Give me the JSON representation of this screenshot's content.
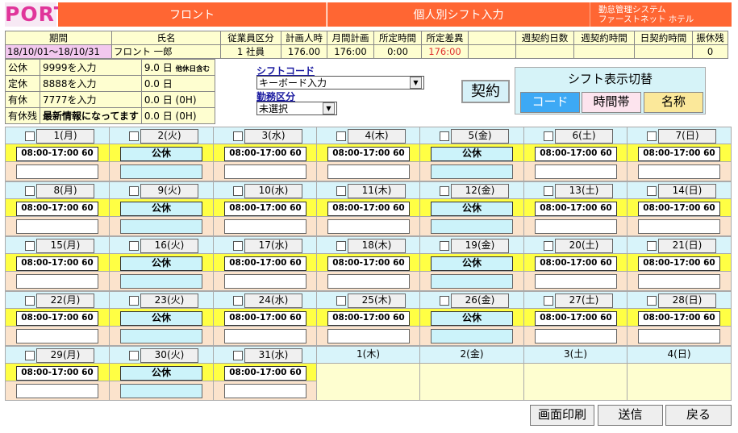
{
  "header": {
    "logo": "PORT",
    "section": "フロント",
    "screen_title": "個人別シフト入力",
    "system_line1": "勤怠管理システム",
    "system_line2": "ファーストネット ホテル"
  },
  "info": {
    "headers": [
      "期間",
      "氏名",
      "従業員区分",
      "計画人時",
      "月間計画",
      "所定時間",
      "所定差異",
      "",
      "週契約日数",
      "週契約時間",
      "日契約時間",
      "振休残"
    ],
    "values": [
      "18/10/01〜18/10/31",
      "フロント 一郎",
      "1 社員",
      "176.00",
      "176:00",
      "0:00",
      "176:00",
      "",
      "",
      "",
      "",
      "0"
    ]
  },
  "summary": [
    {
      "label": "公休",
      "code": "9999を入力",
      "value": "9.0 日",
      "note": "他休日含む"
    },
    {
      "label": "定休",
      "code": "8888を入力",
      "value": "0.0 日",
      "note": ""
    },
    {
      "label": "有休",
      "code": "7777を入力",
      "value": "0.0 日 (0H)",
      "note": ""
    },
    {
      "label": "有休残",
      "code": "最新情報になってます",
      "value": "0.0 日 (0H)",
      "note": ""
    }
  ],
  "controls": {
    "shift_code_label": "シフトコード",
    "shift_code_value": "キーボード入力",
    "work_type_label": "勤務区分",
    "work_type_value": "未選択",
    "contract_button": "契約",
    "display_toggle_title": "シフト表示切替",
    "toggle_code": "コード",
    "toggle_time": "時間帯",
    "toggle_name": "名称"
  },
  "calendar": {
    "days": [
      {
        "label": "1(月)",
        "shift": "08:00-17:00 60",
        "kind": "work"
      },
      {
        "label": "2(火)",
        "shift": "公休",
        "kind": "off"
      },
      {
        "label": "3(水)",
        "shift": "08:00-17:00 60",
        "kind": "work"
      },
      {
        "label": "4(木)",
        "shift": "08:00-17:00 60",
        "kind": "work"
      },
      {
        "label": "5(金)",
        "shift": "公休",
        "kind": "off"
      },
      {
        "label": "6(土)",
        "shift": "08:00-17:00 60",
        "kind": "work"
      },
      {
        "label": "7(日)",
        "shift": "08:00-17:00 60",
        "kind": "work"
      },
      {
        "label": "8(月)",
        "shift": "08:00-17:00 60",
        "kind": "work"
      },
      {
        "label": "9(火)",
        "shift": "公休",
        "kind": "off"
      },
      {
        "label": "10(水)",
        "shift": "08:00-17:00 60",
        "kind": "work"
      },
      {
        "label": "11(木)",
        "shift": "08:00-17:00 60",
        "kind": "work"
      },
      {
        "label": "12(金)",
        "shift": "公休",
        "kind": "off"
      },
      {
        "label": "13(土)",
        "shift": "08:00-17:00 60",
        "kind": "work"
      },
      {
        "label": "14(日)",
        "shift": "08:00-17:00 60",
        "kind": "work"
      },
      {
        "label": "15(月)",
        "shift": "08:00-17:00 60",
        "kind": "work"
      },
      {
        "label": "16(火)",
        "shift": "公休",
        "kind": "off"
      },
      {
        "label": "17(水)",
        "shift": "08:00-17:00 60",
        "kind": "work"
      },
      {
        "label": "18(木)",
        "shift": "08:00-17:00 60",
        "kind": "work"
      },
      {
        "label": "19(金)",
        "shift": "公休",
        "kind": "off"
      },
      {
        "label": "20(土)",
        "shift": "08:00-17:00 60",
        "kind": "work"
      },
      {
        "label": "21(日)",
        "shift": "08:00-17:00 60",
        "kind": "work"
      },
      {
        "label": "22(月)",
        "shift": "08:00-17:00 60",
        "kind": "work"
      },
      {
        "label": "23(火)",
        "shift": "公休",
        "kind": "off"
      },
      {
        "label": "24(水)",
        "shift": "08:00-17:00 60",
        "kind": "work"
      },
      {
        "label": "25(木)",
        "shift": "08:00-17:00 60",
        "kind": "work"
      },
      {
        "label": "26(金)",
        "shift": "公休",
        "kind": "off"
      },
      {
        "label": "27(土)",
        "shift": "08:00-17:00 60",
        "kind": "work"
      },
      {
        "label": "28(日)",
        "shift": "08:00-17:00 60",
        "kind": "work"
      },
      {
        "label": "29(月)",
        "shift": "08:00-17:00 60",
        "kind": "work"
      },
      {
        "label": "30(火)",
        "shift": "公休",
        "kind": "off"
      },
      {
        "label": "31(水)",
        "shift": "08:00-17:00 60",
        "kind": "work"
      }
    ],
    "next_month_days": [
      "1(木)",
      "2(金)",
      "3(土)",
      "4(日)"
    ]
  },
  "footer": {
    "print_button": "画面印刷",
    "send_button": "送信",
    "back_button": "戻る"
  },
  "colors": {
    "header_orange": "#ff6633",
    "logo_pink": "#e0359a",
    "shift_row_yellow": "#ffff44",
    "day_row_blue": "#d8f4fa",
    "input_row_peach": "#fbe3cc"
  }
}
